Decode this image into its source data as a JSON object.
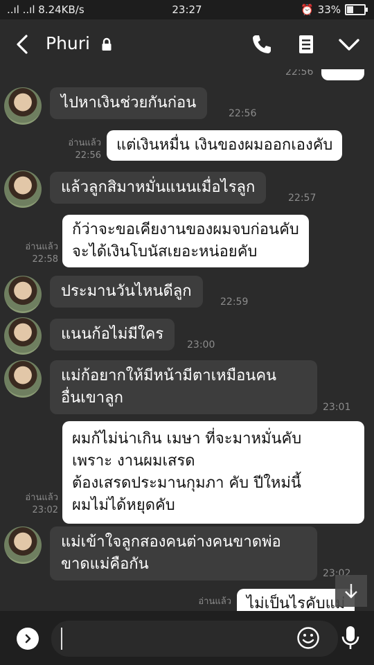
{
  "status_bar": {
    "signal": "..ıl ..ıl 8.24KB/s",
    "time": "23:27",
    "battery": "33%"
  },
  "header": {
    "title": "Phuri",
    "icons": [
      "back-icon",
      "lock-icon",
      "phone-icon",
      "menu-icon",
      "chevron-down-icon"
    ]
  },
  "messages": [
    {
      "side": "out",
      "time": "22:56"
    },
    {
      "side": "in",
      "text": "ไปหาเงินช่วยกันก่อน",
      "time": "22:56"
    },
    {
      "side": "out",
      "text": "แต่เงินหมื่น เงินของผมออกเองคับ",
      "read": "อ่านแล้ว",
      "time": "22:56"
    },
    {
      "side": "in",
      "text": "แล้วลูกสิมาหมั่นแนนเมื่อไรลูก",
      "time": "22:57"
    },
    {
      "side": "out",
      "lines": [
        "ก้ว่าจะขอเคียงานของผมจบก่อนคับ",
        "จะได้เงินโบนัสเยอะหน่อยคับ"
      ],
      "read": "อ่านแล้ว",
      "time": "22:58"
    },
    {
      "side": "in",
      "text": "ประมานวันไหนดีลูก",
      "time": "22:59"
    },
    {
      "side": "in",
      "text": "แนนก้อไม่มีใคร",
      "time": "23:00"
    },
    {
      "side": "in",
      "lines": [
        "แม่ก้อยากให้มีหน้ามีตาเหมือนคน",
        "อื่นเขาลูก"
      ],
      "time": "23:01"
    },
    {
      "side": "out",
      "lines": [
        "ผมก้ไม่น่าเกิน เมษา ที่จะมาหมั่นคับ",
        "เพราะ งานผมเสรด",
        "ต้องเสรดประมานกุมภา คับ ปีใหม่นี้",
        "ผมไม่ได้หยุดคับ"
      ],
      "read": "อ่านแล้ว",
      "time": "23:02"
    },
    {
      "side": "in",
      "lines": [
        "แม่เข้าใจลูกสองคนต่างคนขาดพ่อ",
        "ขาดแม่คือกัน"
      ],
      "time": "23:02"
    },
    {
      "side": "out",
      "text": "ไม่เป็นไรคับแม่",
      "read": "อ่านแล้ว"
    }
  ],
  "input": {
    "placeholder": "",
    "icons": [
      "expand-icon",
      "emoji-icon",
      "microphone-icon"
    ]
  },
  "colors": {
    "background": "#2b2b2b",
    "incoming_bubble": "#3d3d3d",
    "outgoing_bubble": "#ffffff"
  }
}
